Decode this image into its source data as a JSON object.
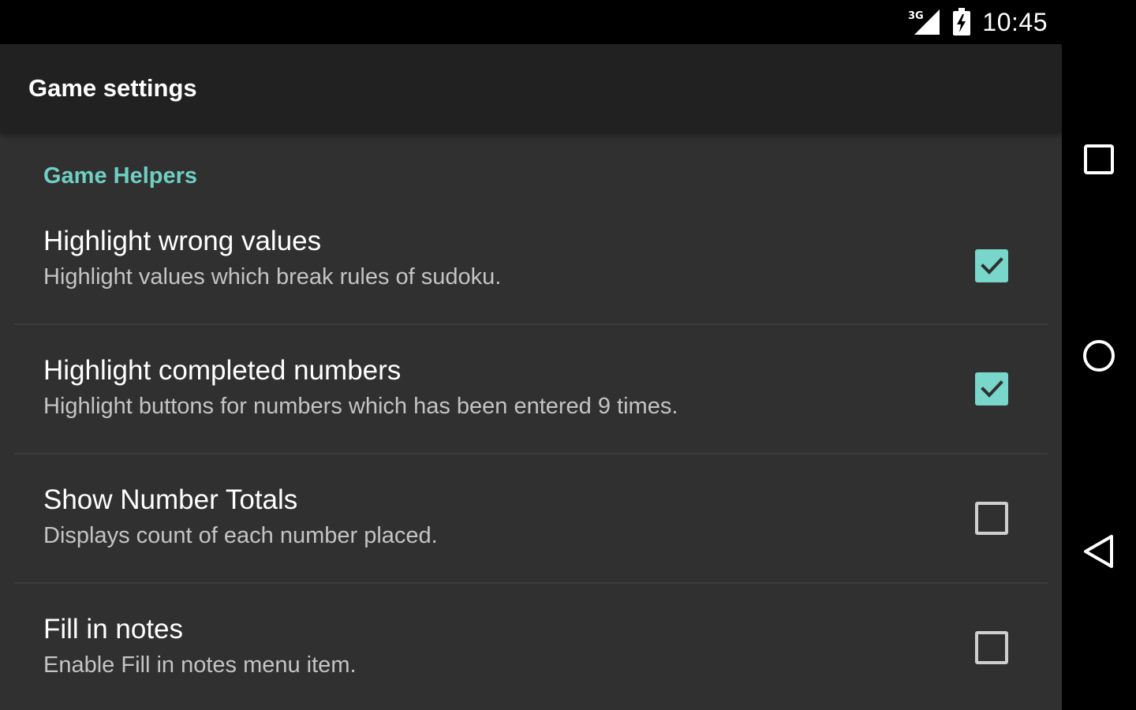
{
  "status_bar": {
    "network_label": "3G",
    "time": "10:45",
    "icons": [
      "signal-3g-icon",
      "battery-charging-icon"
    ]
  },
  "toolbar": {
    "title": "Game settings"
  },
  "section": {
    "title": "Game Helpers"
  },
  "preferences": [
    {
      "title": "Highlight wrong values",
      "summary": "Highlight values which break rules of sudoku.",
      "checked": true
    },
    {
      "title": "Highlight completed numbers",
      "summary": "Highlight buttons for numbers which has been entered 9 times.",
      "checked": true
    },
    {
      "title": "Show Number Totals",
      "summary": "Displays count of each number placed.",
      "checked": false
    },
    {
      "title": "Fill in notes",
      "summary": "Enable Fill in notes menu item.",
      "checked": false
    }
  ],
  "nav_bar": {
    "buttons": [
      "recents-icon",
      "home-icon",
      "back-icon"
    ]
  },
  "colors": {
    "accent": "#78d6cb",
    "section_header": "#6fcfc3",
    "background": "#303030",
    "toolbar": "#212121"
  }
}
